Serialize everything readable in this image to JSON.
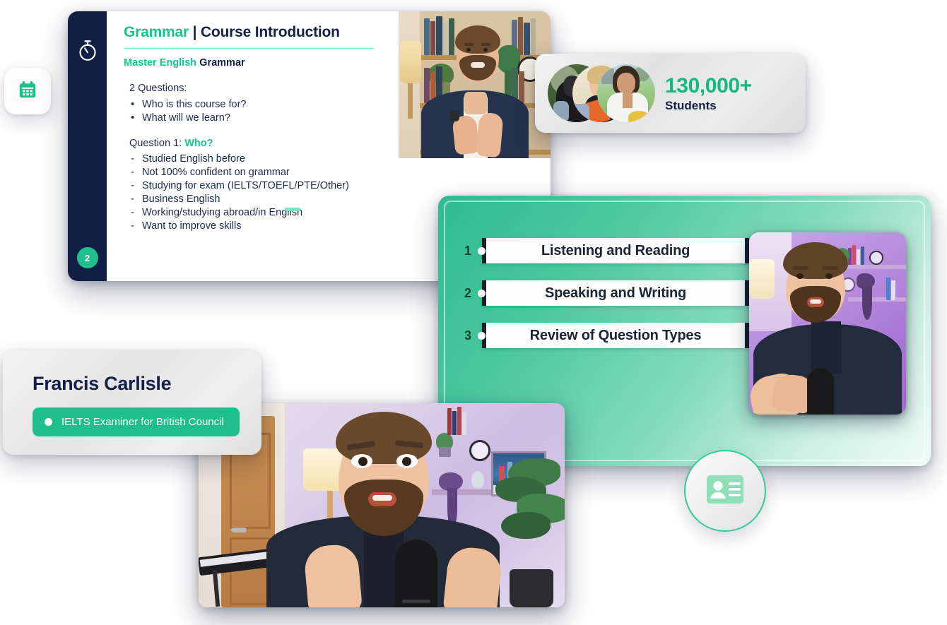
{
  "theme": {
    "green": "#20bf8c",
    "green_bright": "#15c48b",
    "navy": "#13204a",
    "rail_navy": "#121f45",
    "white": "#ffffff"
  },
  "calendar_chip": {
    "icon": "calendar-icon"
  },
  "slide": {
    "rail": {
      "icon": "stopwatch-icon",
      "page_badge": "2"
    },
    "title_accent": "Grammar",
    "title_rest": " | Course Introduction",
    "subtitle_accent": "Master English",
    "subtitle_rest": " Grammar",
    "questions_heading": "2 Questions:",
    "questions": [
      "Who is this course for?",
      "What will we learn?"
    ],
    "question1_label": "Question 1: ",
    "question1_accent": "Who?",
    "answers": [
      "Studied English before",
      "Not 100% confident on grammar",
      "Studying for exam (IELTS/TOEFL/PTE/Other)",
      "Business English",
      "Working/studying abroad/in English",
      "Want to improve skills"
    ]
  },
  "students_card": {
    "count": "130,000+",
    "label": "Students",
    "avatars": [
      "student-avatar-1",
      "student-avatar-2",
      "student-avatar-3"
    ]
  },
  "agenda": {
    "rows": [
      {
        "number": "1",
        "label": "Listening and Reading"
      },
      {
        "number": "2",
        "label": "Speaking and Writing"
      },
      {
        "number": "3",
        "label": "Review of Question Types"
      }
    ]
  },
  "id_badge": {
    "icon": "id-card-icon"
  },
  "presenter_card": {
    "name": "Francis Carlisle",
    "role": "IELTS Examiner for British Council"
  },
  "videos": {
    "blazer_thumb": "presenter-video-bookshelf",
    "purple_thumb": "presenter-video-purple",
    "main_thumb": "presenter-video-main"
  }
}
